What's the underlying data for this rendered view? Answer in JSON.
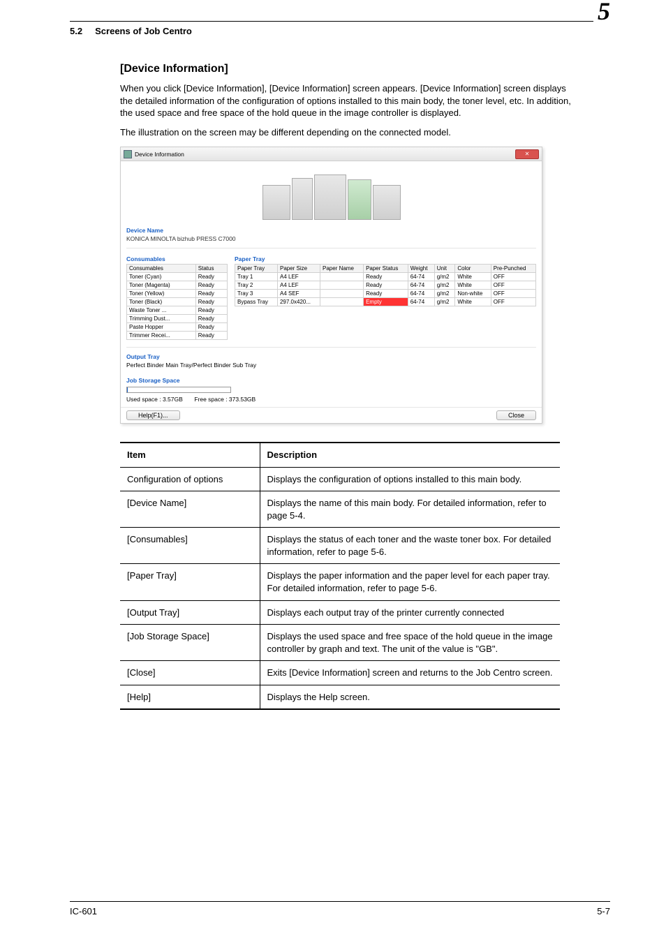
{
  "header": {
    "section_num": "5.2",
    "section_title": "Screens of Job Centro",
    "chapter_num": "5"
  },
  "subsection_title": "[Device Information]",
  "paragraphs": {
    "p1": "When you click [Device Information], [Device Information] screen appears. [Device Information] screen displays the detailed information of the configuration of options installed to this main body, the toner level, etc. In addition, the used space and free space of the hold queue in the image controller is displayed.",
    "p2": "The illustration on the screen may be different depending on the connected model."
  },
  "window": {
    "title": "Device Information",
    "close_glyph": "✕",
    "labels": {
      "device_name": "Device Name",
      "consumables": "Consumables",
      "paper_tray": "Paper Tray",
      "output_tray": "Output Tray",
      "job_storage": "Job Storage Space"
    },
    "device_name_value": "KONICA MINOLTA bizhub PRESS C7000",
    "consumables_headers": [
      "Consumables",
      "Status"
    ],
    "consumables_rows": [
      [
        "Toner (Cyan)",
        "Ready"
      ],
      [
        "Toner (Magenta)",
        "Ready"
      ],
      [
        "Toner (Yellow)",
        "Ready"
      ],
      [
        "Toner (Black)",
        "Ready"
      ],
      [
        "Waste Toner ...",
        "Ready"
      ],
      [
        "Trimming Dust...",
        "Ready"
      ],
      [
        "Paste Hopper",
        "Ready"
      ],
      [
        "Trimmer Recei...",
        "Ready"
      ]
    ],
    "papertray_headers": [
      "Paper Tray",
      "Paper Size",
      "Paper Name",
      "Paper Status",
      "Weight",
      "Unit",
      "Color",
      "Pre-Punched"
    ],
    "papertray_rows": [
      [
        "Tray 1",
        "A4 LEF",
        "",
        "Ready",
        "64-74",
        "g/m2",
        "White",
        "OFF"
      ],
      [
        "Tray 2",
        "A4 LEF",
        "",
        "Ready",
        "64-74",
        "g/m2",
        "White",
        "OFF"
      ],
      [
        "Tray 3",
        "A4 SEF",
        "",
        "Ready",
        "64-74",
        "g/m2",
        "Non-white",
        "OFF"
      ],
      [
        "Bypass Tray",
        "297.0x420...",
        "",
        "Empty",
        "64-74",
        "g/m2",
        "White",
        "OFF"
      ]
    ],
    "output_tray_value": "Perfect Binder Main Tray/Perfect Binder Sub Tray",
    "used_space": "Used space : 3.57GB",
    "free_space": "Free space : 373.53GB",
    "help_button": "Help(F1)...",
    "close_button": "Close"
  },
  "desc_table": {
    "head_item": "Item",
    "head_desc": "Description",
    "rows": [
      {
        "item": "Configuration of options",
        "desc": "Displays the configuration of options installed to this main body."
      },
      {
        "item": "[Device Name]",
        "desc": "Displays the name of this main body. For detailed information, refer to page 5-4."
      },
      {
        "item": "[Consumables]",
        "desc": "Displays the status of each toner and the waste toner box. For detailed information, refer to page 5-6."
      },
      {
        "item": "[Paper Tray]",
        "desc": "Displays the paper information and the paper level for each paper tray. For detailed information, refer to page 5-6."
      },
      {
        "item": "[Output Tray]",
        "desc": "Displays each output tray of the printer currently connected"
      },
      {
        "item": "[Job Storage Space]",
        "desc": "Displays the used space and free space of the hold queue in the image controller by graph and text. The unit of the value is \"GB\"."
      },
      {
        "item": "[Close]",
        "desc": "Exits [Device Information] screen and returns to the Job Centro screen."
      },
      {
        "item": "[Help]",
        "desc": "Displays the Help screen."
      }
    ]
  },
  "footer": {
    "left": "IC-601",
    "right": "5-7"
  }
}
